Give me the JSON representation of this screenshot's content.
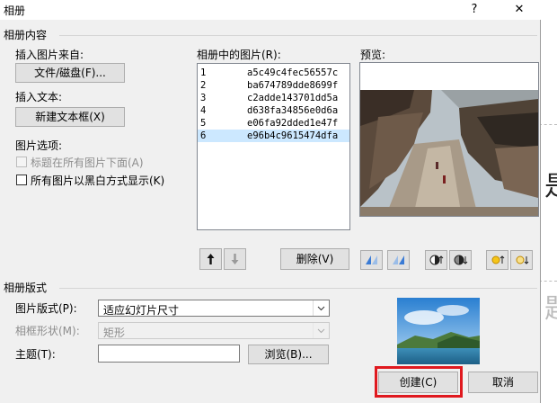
{
  "window": {
    "title": "相册",
    "help_label": "?",
    "close_label": "✕"
  },
  "album_content": {
    "section_label": "相册内容",
    "insert_from_label": "插入图片来自:",
    "file_disk_button": "文件/磁盘(F)...",
    "insert_text_label": "插入文本:",
    "new_textbox_button": "新建文本框(X)",
    "picture_options_label": "图片选项:",
    "captions_option": "标题在所有图片下面(A)",
    "bw_option": "所有图片以黑白方式显示(K)"
  },
  "pictures": {
    "label": "相册中的图片(R):",
    "items": [
      {
        "num": "1",
        "name": "a5c49c4fec56557c"
      },
      {
        "num": "2",
        "name": "ba674789dde8699f"
      },
      {
        "num": "3",
        "name": "c2adde143701dd5a"
      },
      {
        "num": "4",
        "name": "d638fa34856e0d6a"
      },
      {
        "num": "5",
        "name": "e06fa92dded1e47f"
      },
      {
        "num": "6",
        "name": "e96b4c9615474dfa"
      }
    ],
    "selected_index": 6,
    "move_up_icon": "arrow-up-icon",
    "move_down_icon": "arrow-down-icon",
    "remove_button": "删除(V)"
  },
  "preview": {
    "label": "预览:",
    "tools": [
      "rotate-left-icon",
      "rotate-right-icon",
      "contrast-up-icon",
      "contrast-down-icon",
      "brightness-up-icon",
      "brightness-down-icon"
    ]
  },
  "layout": {
    "section_label": "相册版式",
    "picture_layout_label": "图片版式(P):",
    "picture_layout_value": "适应幻灯片尺寸",
    "frame_shape_label": "相框形状(M):",
    "frame_shape_value": "矩形",
    "theme_label": "主题(T):",
    "theme_value": "",
    "browse_button": "浏览(B)..."
  },
  "footer": {
    "create_button": "创建(C)",
    "cancel_button": "取消"
  },
  "colors": {
    "highlight": "#e0191f",
    "selection": "#cce8ff"
  }
}
